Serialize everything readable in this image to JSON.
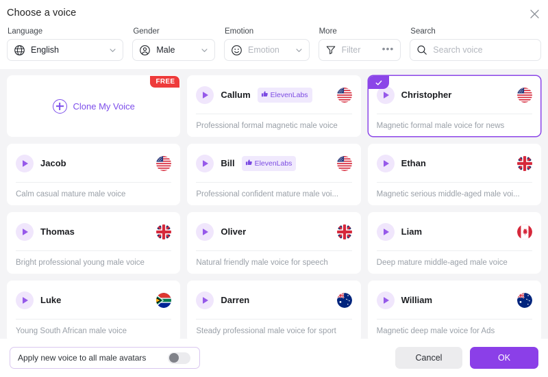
{
  "dialog": {
    "title": "Choose a voice",
    "close_icon": "close-icon"
  },
  "filters": {
    "language": {
      "label": "Language",
      "value": "English",
      "icon": "globe-icon",
      "caret": "chevron-down-icon"
    },
    "gender": {
      "label": "Gender",
      "value": "Male",
      "icon": "user-circle-icon",
      "caret": "chevron-down-icon"
    },
    "emotion": {
      "label": "Emotion",
      "placeholder": "Emotion",
      "icon": "smiley-icon",
      "caret": "chevron-down-icon"
    },
    "more": {
      "label": "More",
      "value": "Filter",
      "icon": "funnel-icon",
      "overflow": "•••"
    },
    "search": {
      "label": "Search",
      "placeholder": "Search voice",
      "value": "",
      "icon": "search-icon"
    }
  },
  "clone_card": {
    "label": "Clone My Voice",
    "badge": "FREE",
    "plus_icon": "plus-circle-icon"
  },
  "voices": [
    {
      "name": "Callum",
      "desc": "Professional formal magnetic male voice",
      "flag": "us",
      "provider": "ElevenLabs",
      "selected": false
    },
    {
      "name": "Christopher",
      "desc": "Magnetic formal male voice for news",
      "flag": "us",
      "provider": "",
      "selected": true
    },
    {
      "name": "Jacob",
      "desc": "Calm casual mature male voice",
      "flag": "us",
      "provider": "",
      "selected": false
    },
    {
      "name": "Bill",
      "desc": "Professional confident mature male voi...",
      "flag": "us",
      "provider": "ElevenLabs",
      "selected": false
    },
    {
      "name": "Ethan",
      "desc": "Magnetic serious middle-aged male voi...",
      "flag": "gb",
      "provider": "",
      "selected": false
    },
    {
      "name": "Thomas",
      "desc": "Bright professional young male voice",
      "flag": "gb",
      "provider": "",
      "selected": false
    },
    {
      "name": "Oliver",
      "desc": "Natural friendly male voice for speech",
      "flag": "gb",
      "provider": "",
      "selected": false
    },
    {
      "name": "Liam",
      "desc": "Deep mature middle-aged male voice",
      "flag": "ca",
      "provider": "",
      "selected": false
    },
    {
      "name": "Luke",
      "desc": "Young South African male voice",
      "flag": "za",
      "provider": "",
      "selected": false
    },
    {
      "name": "Darren",
      "desc": "Steady professional male voice for sport",
      "flag": "au",
      "provider": "",
      "selected": false
    },
    {
      "name": "William",
      "desc": "Magnetic deep male voice for Ads",
      "flag": "au",
      "provider": "",
      "selected": false
    }
  ],
  "footer": {
    "apply_label": "Apply new voice to all male avatars",
    "apply_toggle_on": false,
    "cancel_label": "Cancel",
    "ok_label": "OK"
  },
  "colors": {
    "accent": "#8b3fe8",
    "accent_light": "#f0e6fc",
    "badge_free": "#ee3b3b",
    "body_bg": "#f4f4f6"
  }
}
